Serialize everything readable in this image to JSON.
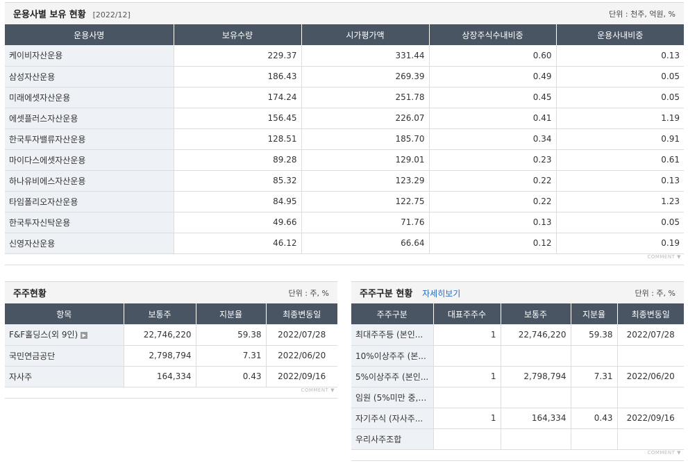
{
  "fund_panel": {
    "title": "운용사별 보유 현황",
    "period": "[2022/12]",
    "unit": "단위 : 천주, 억원, %",
    "headers": [
      "운용사명",
      "보유수량",
      "시가평가액",
      "상장주식수내비중",
      "운용사내비중"
    ],
    "rows": [
      [
        "케이비자산운용",
        "229.37",
        "331.44",
        "0.60",
        "0.13"
      ],
      [
        "삼성자산운용",
        "186.43",
        "269.39",
        "0.49",
        "0.05"
      ],
      [
        "미래에셋자산운용",
        "174.24",
        "251.78",
        "0.45",
        "0.05"
      ],
      [
        "에셋플러스자산운용",
        "156.45",
        "226.07",
        "0.41",
        "1.19"
      ],
      [
        "한국투자밸류자산운용",
        "128.51",
        "185.70",
        "0.34",
        "0.91"
      ],
      [
        "마이다스에셋자산운용",
        "89.28",
        "129.01",
        "0.23",
        "0.61"
      ],
      [
        "하나유비에스자산운용",
        "85.32",
        "123.29",
        "0.22",
        "0.13"
      ],
      [
        "타임폴리오자산운용",
        "84.95",
        "122.75",
        "0.22",
        "1.23"
      ],
      [
        "한국투자신탁운용",
        "49.66",
        "71.76",
        "0.13",
        "0.05"
      ],
      [
        "신영자산운용",
        "46.12",
        "66.64",
        "0.12",
        "0.19"
      ]
    ],
    "comment": "COMMENT"
  },
  "shareholder_panel": {
    "title": "주주현황",
    "unit": "단위 : 주, %",
    "headers": [
      "항목",
      "보통주",
      "지분율",
      "최종변동일"
    ],
    "rows": [
      [
        "F&F홀딩스(외 9인)",
        "22,746,220",
        "59.38",
        "2022/07/28"
      ],
      [
        "국민연금공단",
        "2,798,794",
        "7.31",
        "2022/06/20"
      ],
      [
        "자사주",
        "164,334",
        "0.43",
        "2022/09/16"
      ]
    ],
    "comment": "COMMENT"
  },
  "class_panel": {
    "title": "주주구분 현황",
    "link": "자세히보기",
    "unit": "단위 : 주, %",
    "headers": [
      "주주구분",
      "대표주주수",
      "보통주",
      "지분율",
      "최종변동일"
    ],
    "rows": [
      [
        "최대주주등 (본인...",
        "1",
        "22,746,220",
        "59.38",
        "2022/07/28"
      ],
      [
        "10%이상주주 (본...",
        "",
        "",
        "",
        ""
      ],
      [
        "5%이상주주 (본인...",
        "1",
        "2,798,794",
        "7.31",
        "2022/06/20"
      ],
      [
        "임원 (5%미만 중, ...",
        "",
        "",
        "",
        ""
      ],
      [
        "자기주식 (자사주...",
        "1",
        "164,334",
        "0.43",
        "2022/09/16"
      ],
      [
        "우리사주조합",
        "",
        "",
        "",
        ""
      ]
    ],
    "comment": "COMMENT"
  }
}
